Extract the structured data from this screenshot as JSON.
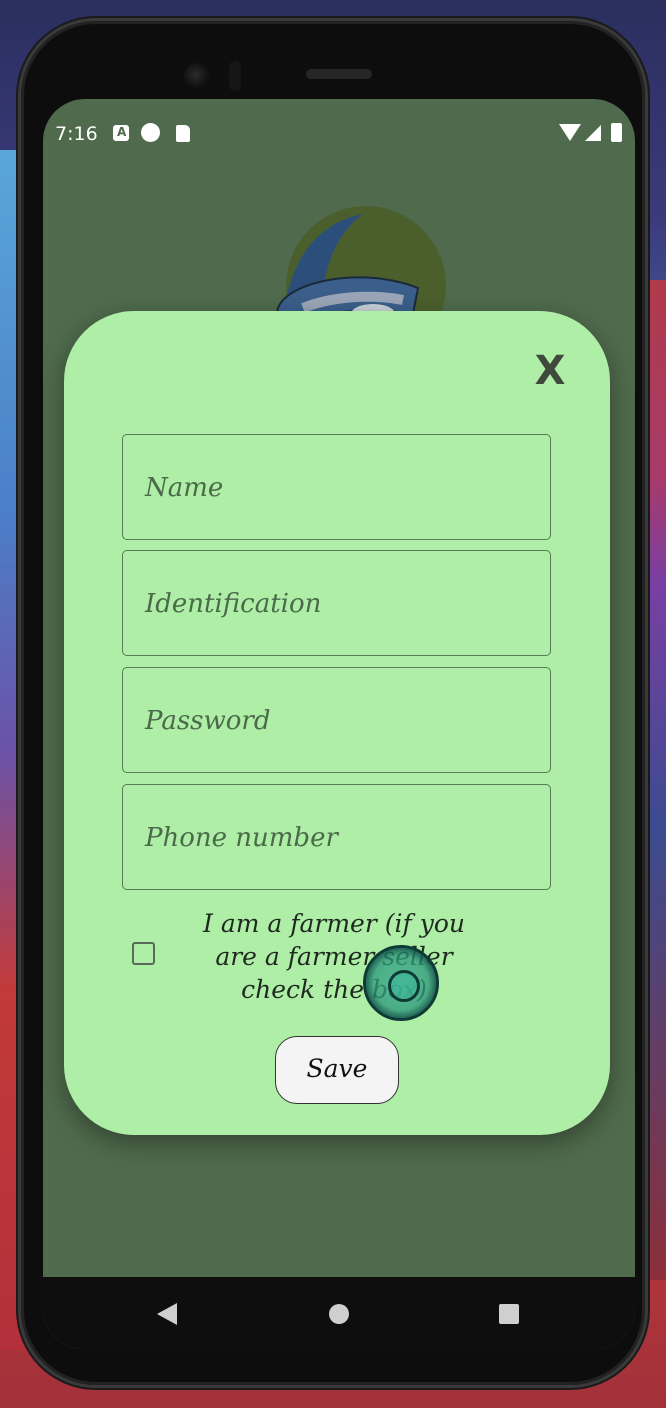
{
  "status_bar": {
    "time": "7:16",
    "icons": [
      "a-notification-icon",
      "p-notification-icon",
      "sd-card-icon",
      "wifi-icon",
      "signal-icon",
      "battery-icon"
    ]
  },
  "dialog": {
    "close_label": "X",
    "fields": {
      "name_placeholder": "Name",
      "identification_placeholder": "Identification",
      "password_placeholder": "Password",
      "phone_placeholder": "Phone number"
    },
    "farmer_checkbox": {
      "checked": false,
      "label_line1": "I am a farmer (if you",
      "label_line2": "are a farmer seller",
      "label_line3": "check the box)"
    },
    "save_label": "Save"
  },
  "navigation": {
    "icons": [
      "back-icon",
      "home-icon",
      "recents-icon"
    ]
  },
  "colors": {
    "dialog_background": "#afeea7",
    "screen_background": "#4f6a4c",
    "field_border": "#557a55"
  }
}
